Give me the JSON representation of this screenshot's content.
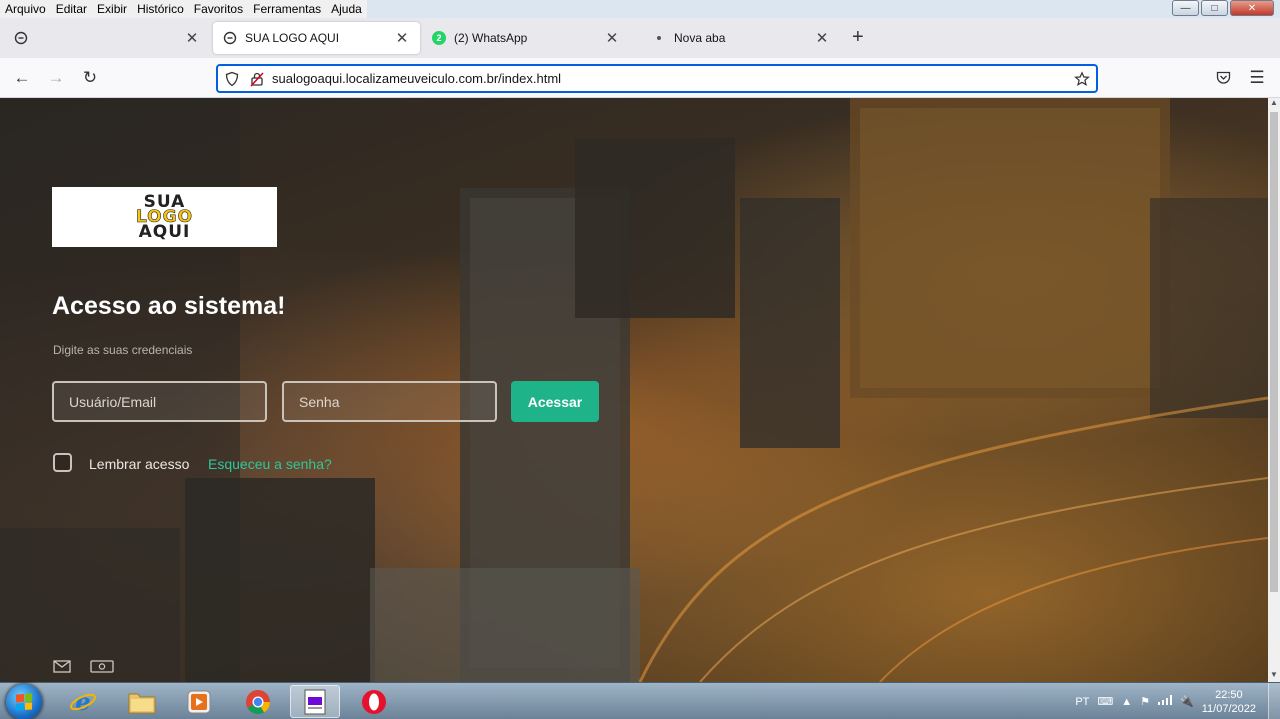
{
  "menubar": {
    "items": [
      "Arquivo",
      "Editar",
      "Exibir",
      "Histórico",
      "Favoritos",
      "Ferramentas",
      "Ajuda"
    ]
  },
  "tabs": [
    {
      "label": "",
      "icon": "blank-page-icon",
      "active": false
    },
    {
      "label": "SUA LOGO AQUI",
      "icon": "site-favicon-icon",
      "active": true
    },
    {
      "label": "(2) WhatsApp",
      "icon": "whatsapp-icon",
      "badge": "2",
      "active": false
    },
    {
      "label": "Nova aba",
      "icon": "dot-icon",
      "active": false
    }
  ],
  "navbar": {
    "url": "sualogoaqui.localizameuveiculo.com.br/index.html"
  },
  "page": {
    "logo": {
      "line1": "SUA",
      "line2": "LOGO",
      "line3": "AQUI"
    },
    "title": "Acesso ao sistema!",
    "subtitle": "Digite as suas credenciais",
    "username_placeholder": "Usuário/Email",
    "password_placeholder": "Senha",
    "submit_label": "Acessar",
    "remember_label": "Lembrar acesso",
    "forgot_link": "Esqueceu a senha?",
    "accent_color": "#1fb38a"
  },
  "taskbar": {
    "language": "PT",
    "time": "22:50",
    "date": "11/07/2022"
  }
}
